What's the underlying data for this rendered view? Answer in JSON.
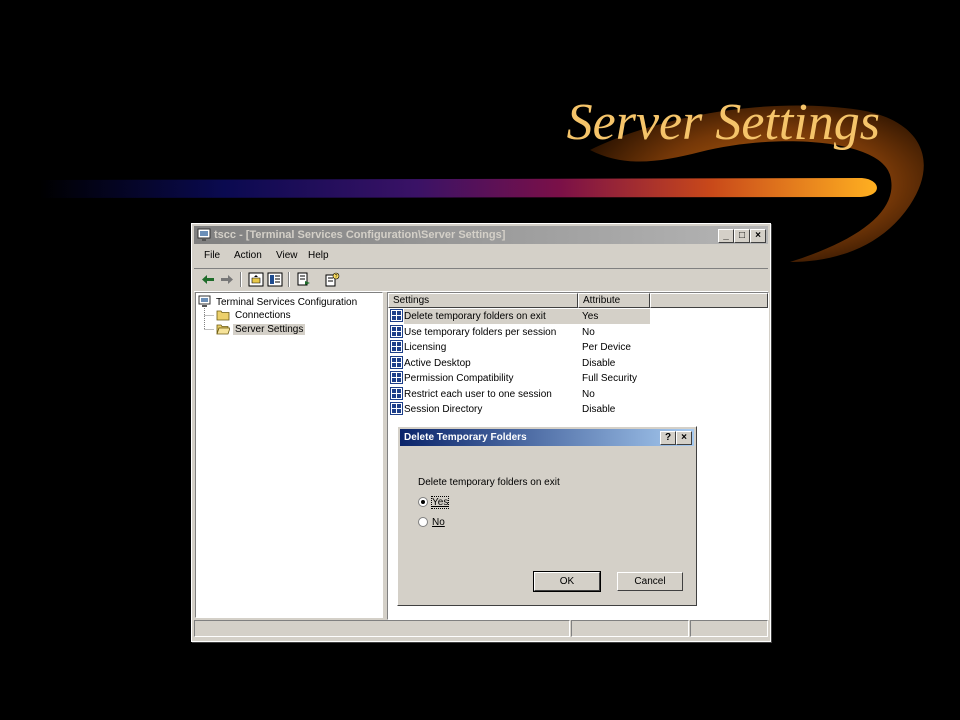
{
  "slide": {
    "title": "Server Settings"
  },
  "window": {
    "title": "tscc - [Terminal Services Configuration\\Server Settings]",
    "controls": {
      "minimize": "_",
      "maximize": "□",
      "close": "×"
    }
  },
  "menu": [
    "File",
    "Action",
    "View",
    "Help"
  ],
  "menu_underline": [
    "F",
    "A",
    "V",
    "H"
  ],
  "toolbar_icons": [
    "back-arrow-icon",
    "forward-arrow-icon",
    "up-folder-icon",
    "show-tree-icon",
    "export-list-icon",
    "properties-help-icon"
  ],
  "tree": {
    "root": "Terminal Services Configuration",
    "children": [
      "Connections",
      "Server Settings"
    ],
    "selected": "Server Settings"
  },
  "list": {
    "columns": [
      "Settings",
      "Attribute"
    ],
    "rows": [
      {
        "setting": "Delete temporary folders on exit",
        "attribute": "Yes"
      },
      {
        "setting": "Use temporary folders per session",
        "attribute": "No"
      },
      {
        "setting": "Licensing",
        "attribute": "Per Device"
      },
      {
        "setting": "Active Desktop",
        "attribute": "Disable"
      },
      {
        "setting": "Permission Compatibility",
        "attribute": "Full Security"
      },
      {
        "setting": "Restrict each user to one session",
        "attribute": "No"
      },
      {
        "setting": "Session Directory",
        "attribute": "Disable"
      }
    ]
  },
  "dialog": {
    "title": "Delete Temporary Folders",
    "help_button": "?",
    "close_button": "×",
    "prompt": "Delete temporary folders on exit",
    "options": [
      "Yes",
      "No"
    ],
    "selected_option": "Yes",
    "ok": "OK",
    "cancel": "Cancel"
  },
  "colors": {
    "title_text": "#f5c46a",
    "dialog_titlebar_start": "#0a246a",
    "dialog_titlebar_end": "#a6caf0",
    "window_face": "#d4d0c8"
  }
}
